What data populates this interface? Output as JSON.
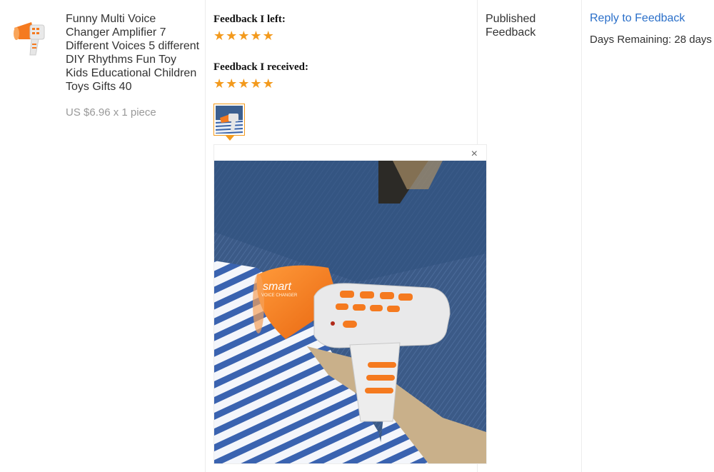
{
  "product": {
    "title": "Funny Multi Voice Changer Amplifier 7 Different Voices 5 different DIY Rhythms Fun Toy Kids Educational Children Toys Gifts 40",
    "price": "US $6.96 x 1 piece",
    "thumbnail_icon": "voice-changer-megaphone-icon"
  },
  "feedback": {
    "left_label": "Feedback I left:",
    "left_rating": 5,
    "received_label": "Feedback I received:",
    "received_rating": 5,
    "star_glyph": "★",
    "photo_close": "×"
  },
  "status": {
    "text": "Published Feedback"
  },
  "actions": {
    "reply_label": "Reply to Feedback",
    "days_remaining": "Days Remaining: 28 days"
  },
  "photo": {
    "brand_text": "smart",
    "brand_sub": "VOICE CHANGER"
  },
  "colors": {
    "accent_orange": "#f39a1d",
    "link_blue": "#2a6fc9",
    "muted_gray": "#999999",
    "toy_orange": "#f57a1f"
  }
}
